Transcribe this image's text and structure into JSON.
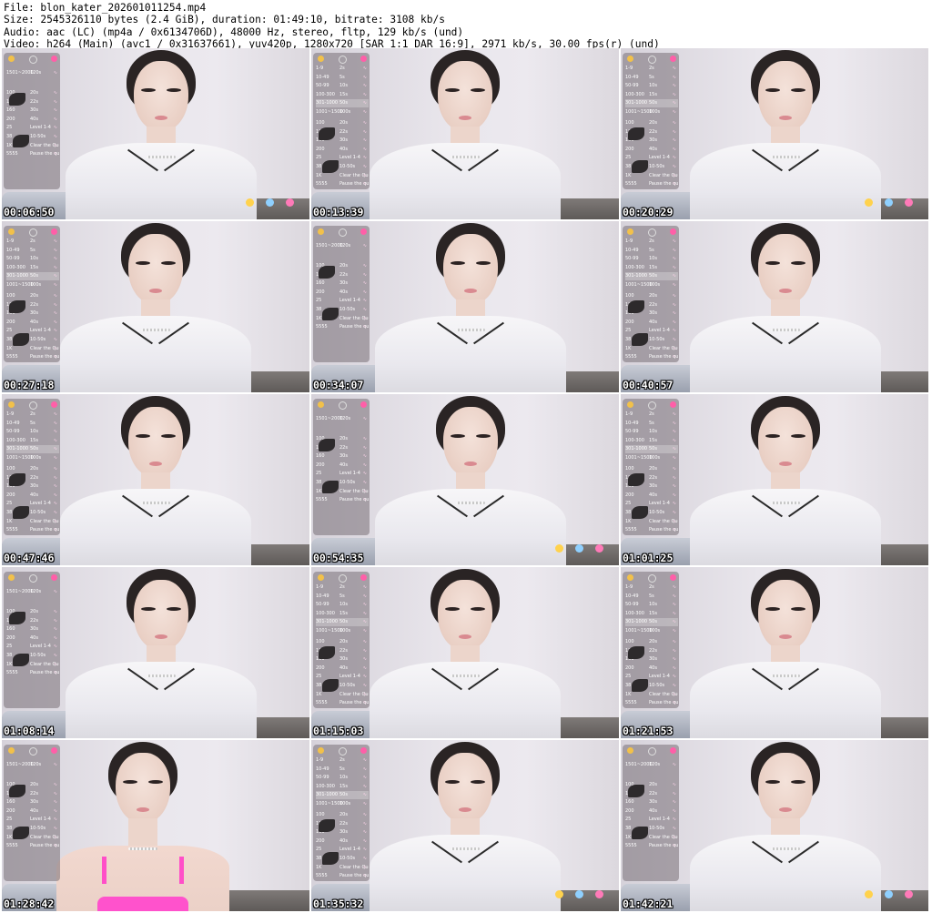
{
  "header": {
    "file": "File: blon_kater_202601011254.mp4",
    "size": "Size: 2545326110 bytes (2.4 GiB), duration: 01:49:10, bitrate: 3108 kb/s",
    "audio": "Audio: aac (LC) (mp4a / 0x6134706D), 48000 Hz, stereo, fltp, 129 kb/s (und)",
    "video": "Video: h264 (Main) (avc1 / 0x31637661), yuv420p, 1280x720 [SAR 1:1 DAR 16:9], 2971 kb/s, 30.00 fps(r) (und)"
  },
  "thumbnails": [
    {
      "time": "00:06:50",
      "variant": "a",
      "panel": "short",
      "stickers": true
    },
    {
      "time": "00:13:39",
      "variant": "b",
      "panel": "full",
      "stickers": false
    },
    {
      "time": "00:20:29",
      "variant": "c",
      "panel": "full",
      "stickers": true
    },
    {
      "time": "00:27:18",
      "variant": "b",
      "panel": "full",
      "stickers": false
    },
    {
      "time": "00:34:07",
      "variant": "a",
      "panel": "short",
      "stickers": false
    },
    {
      "time": "00:40:57",
      "variant": "c",
      "panel": "full",
      "stickers": false
    },
    {
      "time": "00:47:46",
      "variant": "b",
      "panel": "full",
      "stickers": false
    },
    {
      "time": "00:54:35",
      "variant": "a",
      "panel": "short",
      "stickers": true
    },
    {
      "time": "01:01:25",
      "variant": "c",
      "panel": "full",
      "stickers": false
    },
    {
      "time": "01:08:14",
      "variant": "a",
      "panel": "short",
      "stickers": false
    },
    {
      "time": "01:15:03",
      "variant": "b",
      "panel": "full",
      "stickers": false
    },
    {
      "time": "01:21:53",
      "variant": "c",
      "panel": "full",
      "stickers": false
    },
    {
      "time": "01:28:42",
      "variant": "pink",
      "panel": "short",
      "stickers": false
    },
    {
      "time": "01:35:32",
      "variant": "b",
      "panel": "full",
      "stickers": true
    },
    {
      "time": "01:42:21",
      "variant": "c",
      "panel": "short",
      "stickers": true
    }
  ],
  "panel_rows_full": [
    [
      "1-9",
      "2s",
      ""
    ],
    [
      "10-49",
      "5s",
      ""
    ],
    [
      "50-99",
      "10s",
      ""
    ],
    [
      "100-300",
      "15s",
      ""
    ],
    [
      "301-1000",
      "50s",
      ""
    ],
    [
      "1001~1500",
      "100s",
      ""
    ],
    [
      "100",
      "20s",
      ""
    ],
    [
      "120",
      "22s",
      ""
    ],
    [
      "160",
      "30s",
      ""
    ],
    [
      "200",
      "40s",
      ""
    ],
    [
      "25",
      "Level 1-4",
      ""
    ],
    [
      "38",
      "10-50s",
      ""
    ],
    [
      "1K",
      "Clear the Queue",
      ""
    ],
    [
      "5555",
      "Pause the queue",
      ""
    ]
  ],
  "panel_rows_short": [
    [
      "1501~2000",
      "120s",
      ""
    ],
    [
      "100",
      "20s",
      ""
    ],
    [
      "120",
      "22s",
      ""
    ],
    [
      "160",
      "30s",
      ""
    ],
    [
      "200",
      "40s",
      ""
    ],
    [
      "25",
      "Level 1-4",
      ""
    ],
    [
      "38",
      "10-50s",
      ""
    ],
    [
      "1K",
      "Clear the Queue",
      ""
    ],
    [
      "5555",
      "Pause the queue",
      ""
    ]
  ],
  "colors": {
    "panel_accent": "#ff3fa0",
    "timestamp": "#ffffff",
    "pink_top": "#ff52cc"
  }
}
